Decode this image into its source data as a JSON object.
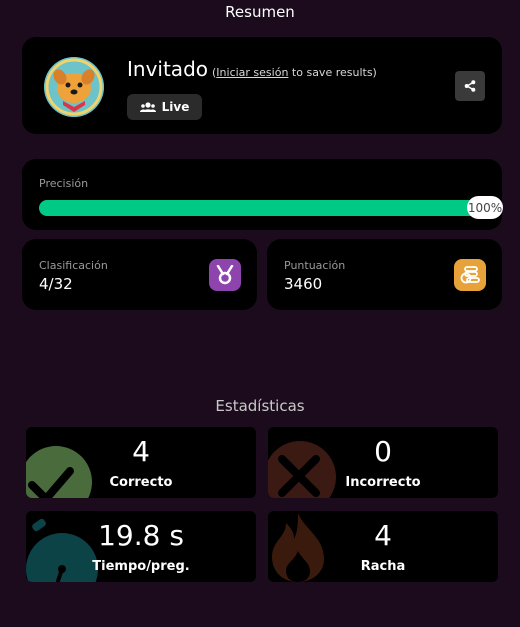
{
  "summary": {
    "title": "Resumen"
  },
  "profile": {
    "name": "Invitado",
    "login_open": "(",
    "login_link": "Iniciar sesión",
    "login_rest": " to save results)",
    "live_label": "Live"
  },
  "accuracy": {
    "label": "Precisión",
    "value_text": "100%",
    "value": 1.0,
    "color": "#00c985"
  },
  "rank": {
    "label": "Clasificación",
    "value": "4/32",
    "icon": "medal-icon",
    "color": "#8e44ad"
  },
  "score": {
    "label": "Puntuación",
    "value": "3460",
    "icon": "coins-icon",
    "color": "#e7a33a"
  },
  "stats": {
    "title": "Estadísticas",
    "correct": {
      "value": "4",
      "label": "Correcto",
      "icon": "check-icon",
      "color": "#4a6b3c"
    },
    "incorrect": {
      "value": "0",
      "label": "Incorrecto",
      "icon": "cross-icon",
      "color": "#3a1a12"
    },
    "time": {
      "value": "19.8 s",
      "label": "Tiempo/preg.",
      "icon": "stopwatch-icon",
      "color": "#0c4347"
    },
    "streak": {
      "value": "4",
      "label": "Racha",
      "icon": "flame-icon",
      "color": "#3a1a0c"
    }
  }
}
